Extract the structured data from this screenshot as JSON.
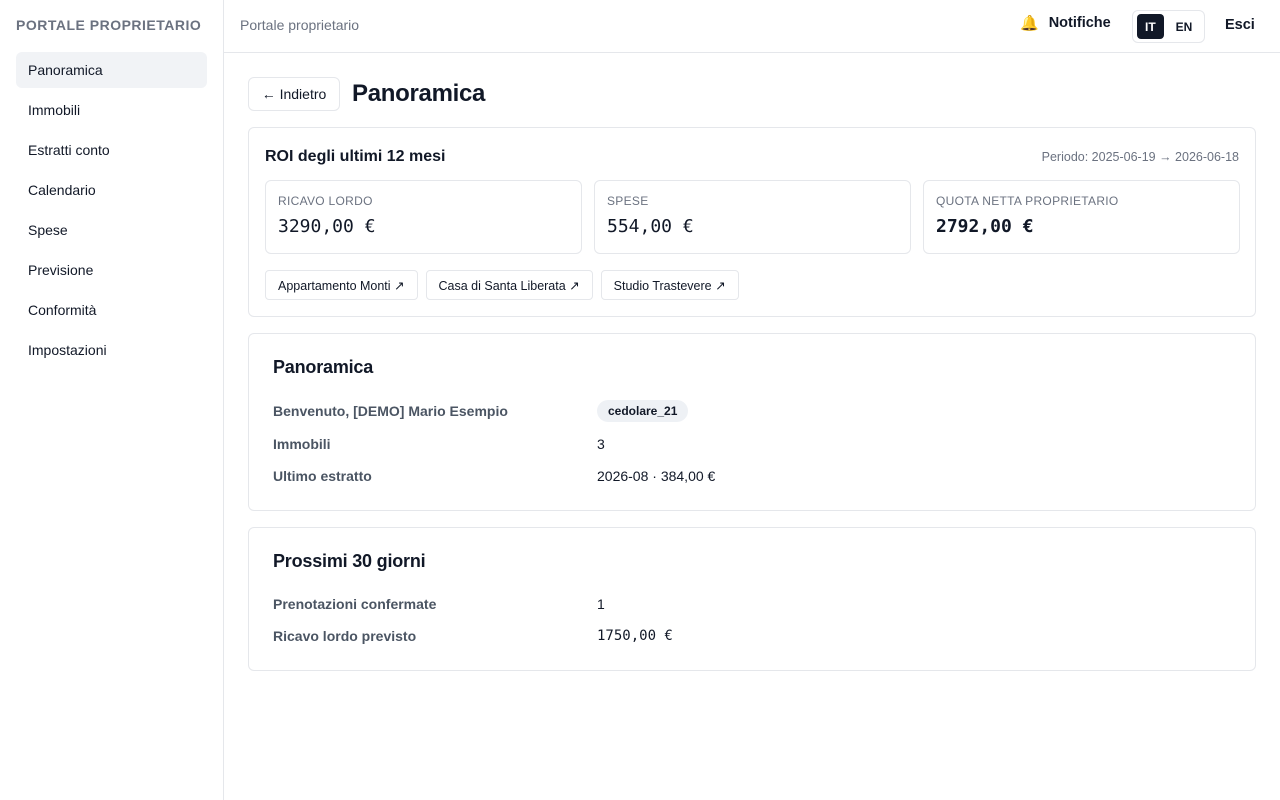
{
  "sidebar": {
    "brand": "PORTALE PROPRIETARIO",
    "items": [
      {
        "label": "Panoramica"
      },
      {
        "label": "Immobili"
      },
      {
        "label": "Estratti conto"
      },
      {
        "label": "Calendario"
      },
      {
        "label": "Spese"
      },
      {
        "label": "Previsione"
      },
      {
        "label": "Conformità"
      },
      {
        "label": "Impostazioni"
      }
    ]
  },
  "header": {
    "title": "Portale proprietario",
    "notifications_label": "Notifiche",
    "bell_icon": "bell-icon",
    "languages": [
      "IT",
      "EN"
    ],
    "active_language": "IT",
    "logout_label": "Esci"
  },
  "page": {
    "back_label": "← Indietro",
    "title": "Panoramica"
  },
  "roi": {
    "title": "ROI degli ultimi 12 mesi",
    "period": "Periodo: 2025-06-19 → 2026-06-18",
    "kpis": [
      {
        "label": "RICAVO LORDO",
        "value": "3290,00 €"
      },
      {
        "label": "SPESE",
        "value": "554,00 €"
      },
      {
        "label": "QUOTA NETTA PROPRIETARIO",
        "value": "2792,00 €"
      }
    ],
    "properties": [
      {
        "label": "Appartamento Monti ↗"
      },
      {
        "label": "Casa di Santa Liberata ↗"
      },
      {
        "label": "Studio Trastevere ↗"
      }
    ]
  },
  "overview": {
    "title": "Panoramica",
    "welcome_label": "Benvenuto, [DEMO] Mario Esempio",
    "tax_badge": "cedolare_21",
    "properties_label": "Immobili",
    "properties_value": "3",
    "last_statement_label": "Ultimo estratto",
    "last_statement_value": "2026-08 · 384,00 €"
  },
  "next30": {
    "title": "Prossimi 30 giorni",
    "bookings_label": "Prenotazioni confermate",
    "bookings_value": "1",
    "revenue_label": "Ricavo lordo previsto",
    "revenue_value": "1750,00 €"
  },
  "colors": {
    "accent": "#111827",
    "active_nav_bg": "#f1f3f6",
    "muted_text": "#6b7280",
    "border": "#e5e7eb"
  }
}
